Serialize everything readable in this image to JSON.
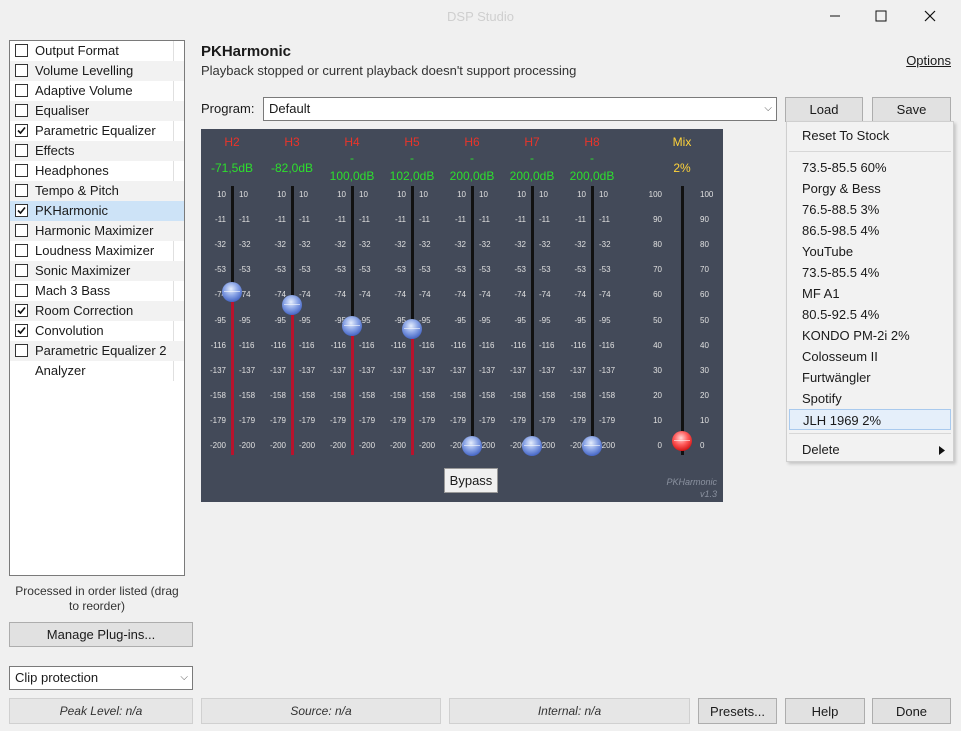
{
  "window": {
    "title": "DSP Studio",
    "controls": [
      "minimize-icon",
      "maximize-icon",
      "close-icon"
    ]
  },
  "plugins": [
    {
      "label": "Output Format",
      "checked": false
    },
    {
      "label": "Volume Levelling",
      "checked": false
    },
    {
      "label": "Adaptive Volume",
      "checked": false
    },
    {
      "label": "Equaliser",
      "checked": false
    },
    {
      "label": "Parametric Equalizer",
      "checked": true
    },
    {
      "label": "Effects",
      "checked": false
    },
    {
      "label": "Headphones",
      "checked": false
    },
    {
      "label": "Tempo & Pitch",
      "checked": false
    },
    {
      "label": "PKHarmonic",
      "checked": true,
      "selected": true
    },
    {
      "label": "Harmonic Maximizer",
      "checked": false
    },
    {
      "label": "Loudness Maximizer",
      "checked": false
    },
    {
      "label": "Sonic Maximizer",
      "checked": false
    },
    {
      "label": "Mach 3 Bass",
      "checked": false
    },
    {
      "label": "Room Correction",
      "checked": true
    },
    {
      "label": "Convolution",
      "checked": true
    },
    {
      "label": "Parametric Equalizer 2",
      "checked": false
    },
    {
      "label": "Analyzer",
      "checked": null
    }
  ],
  "left": {
    "note": "Processed in order listed (drag to reorder)",
    "manage_label": "Manage Plug-ins...",
    "clip_value": "Clip protection"
  },
  "header": {
    "title": "PKHarmonic",
    "subtitle": "Playback stopped or current playback doesn't support processing",
    "options_label": "Options"
  },
  "program": {
    "label": "Program:",
    "value": "Default",
    "load_label": "Load",
    "save_label": "Save"
  },
  "harmonic": {
    "channels": [
      {
        "name": "H2",
        "value_text": "-71,5dB",
        "marker": "",
        "level_db": -71.5
      },
      {
        "name": "H3",
        "value_text": "-82,0dB",
        "marker": "",
        "level_db": -82.0
      },
      {
        "name": "H4",
        "value_text": "100,0dB",
        "marker": "-",
        "level_db": -100
      },
      {
        "name": "H5",
        "value_text": "102,0dB",
        "marker": "-",
        "level_db": -102
      },
      {
        "name": "H6",
        "value_text": "200,0dB",
        "marker": "-",
        "level_db": -200
      },
      {
        "name": "H7",
        "value_text": "200,0dB",
        "marker": "-",
        "level_db": -200
      },
      {
        "name": "H8",
        "value_text": "200,0dB",
        "marker": "-",
        "level_db": -200
      }
    ],
    "db_ticks": [
      "10",
      "-11",
      "-32",
      "-53",
      "-74",
      "-95",
      "-116",
      "-137",
      "-158",
      "-179",
      "-200"
    ],
    "mix": {
      "name": "Mix",
      "value_text": "2%",
      "level": 2
    },
    "mix_ticks": [
      "100",
      "90",
      "80",
      "70",
      "60",
      "50",
      "40",
      "30",
      "20",
      "10",
      "0"
    ],
    "bypass_label": "Bypass",
    "brand": "PKHarmonic",
    "version": "v1.3",
    "colors": {
      "panel": "#434a59",
      "harmonic_label": "#e8342a",
      "value": "#2ddf2d",
      "mix_label": "#ffd33a",
      "fill": "#b8132d"
    }
  },
  "menu": {
    "reset_label": "Reset To Stock",
    "presets": [
      "73.5-85.5 60%",
      "Porgy & Bess",
      "76.5-88.5 3%",
      "86.5-98.5 4%",
      "YouTube",
      "73.5-85.5 4%",
      "MF A1",
      "80.5-92.5 4%",
      "KONDO PM-2i 2%",
      "Colosseum II",
      "Furtwängler",
      "Spotify",
      "JLH 1969 2%"
    ],
    "highlighted": "JLH 1969 2%",
    "delete_label": "Delete"
  },
  "status": {
    "peak": "Peak Level: n/a",
    "source": "Source: n/a",
    "internal": "Internal: n/a",
    "presets_label": "Presets...",
    "help_label": "Help",
    "done_label": "Done"
  }
}
